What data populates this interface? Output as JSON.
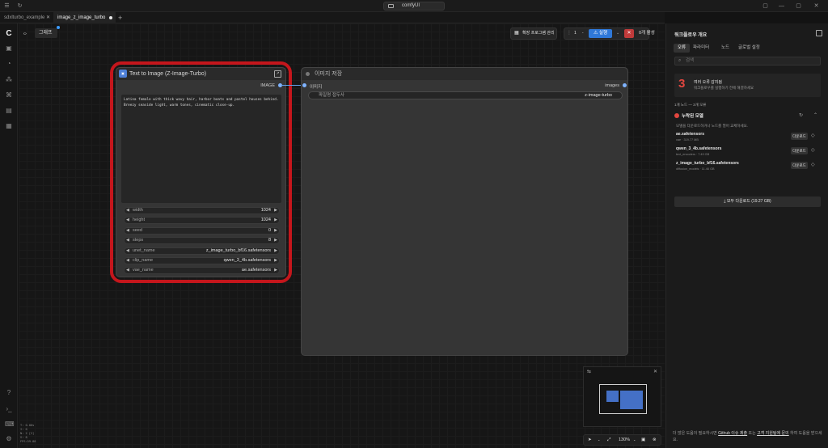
{
  "app": {
    "title": "comfyUI"
  },
  "tabs": [
    {
      "label": "sdxlturbo_example",
      "active": false
    },
    {
      "label": "image_z_image_turbo",
      "active": true
    }
  ],
  "canvas": {
    "menu_glyph": "ᆼ",
    "graph_label": "그래프",
    "toolbar": {
      "manager_label": "확장 프로그램 관리",
      "queue_count": "1",
      "run_label": "실행",
      "queue_label": "0개 활성"
    },
    "stats": [
      "T: 0.00s",
      "I: 0",
      "N: 2 [2]",
      "V: 8",
      "FPS:59.88"
    ],
    "zoom": "130%"
  },
  "node1": {
    "title": "Text to Image (Z-Image-Turbo)",
    "output_label": "IMAGE",
    "prompt": "Latina female with thick wavy hair, harbor boats and pastel houses behind. Breezy seaside light, warm tones, cinematic close-up.",
    "widgets": [
      {
        "label": "width",
        "value": "1024"
      },
      {
        "label": "height",
        "value": "1024"
      },
      {
        "label": "seed",
        "value": "0"
      },
      {
        "label": "steps",
        "value": "8"
      },
      {
        "label": "unet_name",
        "value": "z_image_turbo_bf16.safetensors"
      },
      {
        "label": "clip_name",
        "value": "qwen_3_4b.safetensors"
      },
      {
        "label": "vae_name",
        "value": "ae.safetensors"
      }
    ]
  },
  "node2": {
    "title": "이미지 저장",
    "input_label": "이미지",
    "output_label": "images",
    "prefix_label": "파일명 접두사",
    "prefix_value": "z-image-turbo"
  },
  "panel": {
    "title": "워크플로우 개요",
    "tabs": [
      "오류",
      "파라미터",
      "노드",
      "글로벌 설정"
    ],
    "search_placeholder": "검색",
    "error_count": "3",
    "error_title": "여러 오류 감지됨",
    "error_desc": "워크플로우를 실행하기 전에 해결하세요",
    "summary": "1개 노드 — 3개 오류",
    "missing_title": "누락된 모델",
    "missing_desc": "모델을 다운로드하거나 노드를 열어 교체하세요.",
    "models": [
      {
        "name": "ae.safetensors",
        "sub": "vae · 319.77 MB"
      },
      {
        "name": "qwen_3_4b.safetensors",
        "sub": "text_encoders · 7.49 GB"
      },
      {
        "name": "z_image_turbo_bf16.safetensors",
        "sub": "diffusion_models · 11.46 GB"
      }
    ],
    "download_label": "다운로드",
    "download_all": "모두 다운로드 (19.27 GB)",
    "footer_prefix": "더 많은 도움이 필요하시면",
    "footer_link1": "Github 이슈 제출",
    "footer_mid": "또는",
    "footer_link2": "고객 지원팀에 문의",
    "footer_suffix": "하여 도움을 받으세요."
  }
}
